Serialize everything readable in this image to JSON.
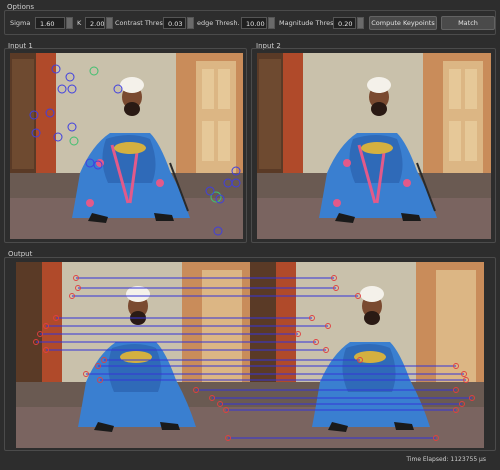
{
  "options": {
    "title": "Options",
    "sigma_label": "Sigma",
    "sigma_value": "1.60",
    "k_label": "K",
    "k_value": "2.00",
    "contrast_label": "Contrast Thresh",
    "contrast_value": "0.03",
    "edge_label": "edge Thresh.",
    "edge_value": "10.00",
    "magnitude_label": "Magnitude Thresh.",
    "magnitude_value": "0.20",
    "compute_button": "Compute Keypoints",
    "match_button": "Match"
  },
  "input1": {
    "title": "Input 1"
  },
  "input2": {
    "title": "Input 2"
  },
  "output": {
    "title": "Output"
  },
  "status": {
    "time_elapsed": "Time Elapsed: 1123755 µs"
  },
  "colors": {
    "keypoint": "#3f3fe0",
    "keypoint_alt": "#3fbf6f",
    "match_line": "#3434d8",
    "match_end": "#e04040",
    "robe": "#3a7fd0",
    "wall": "#c8c0a8",
    "door": "#d8b080"
  }
}
